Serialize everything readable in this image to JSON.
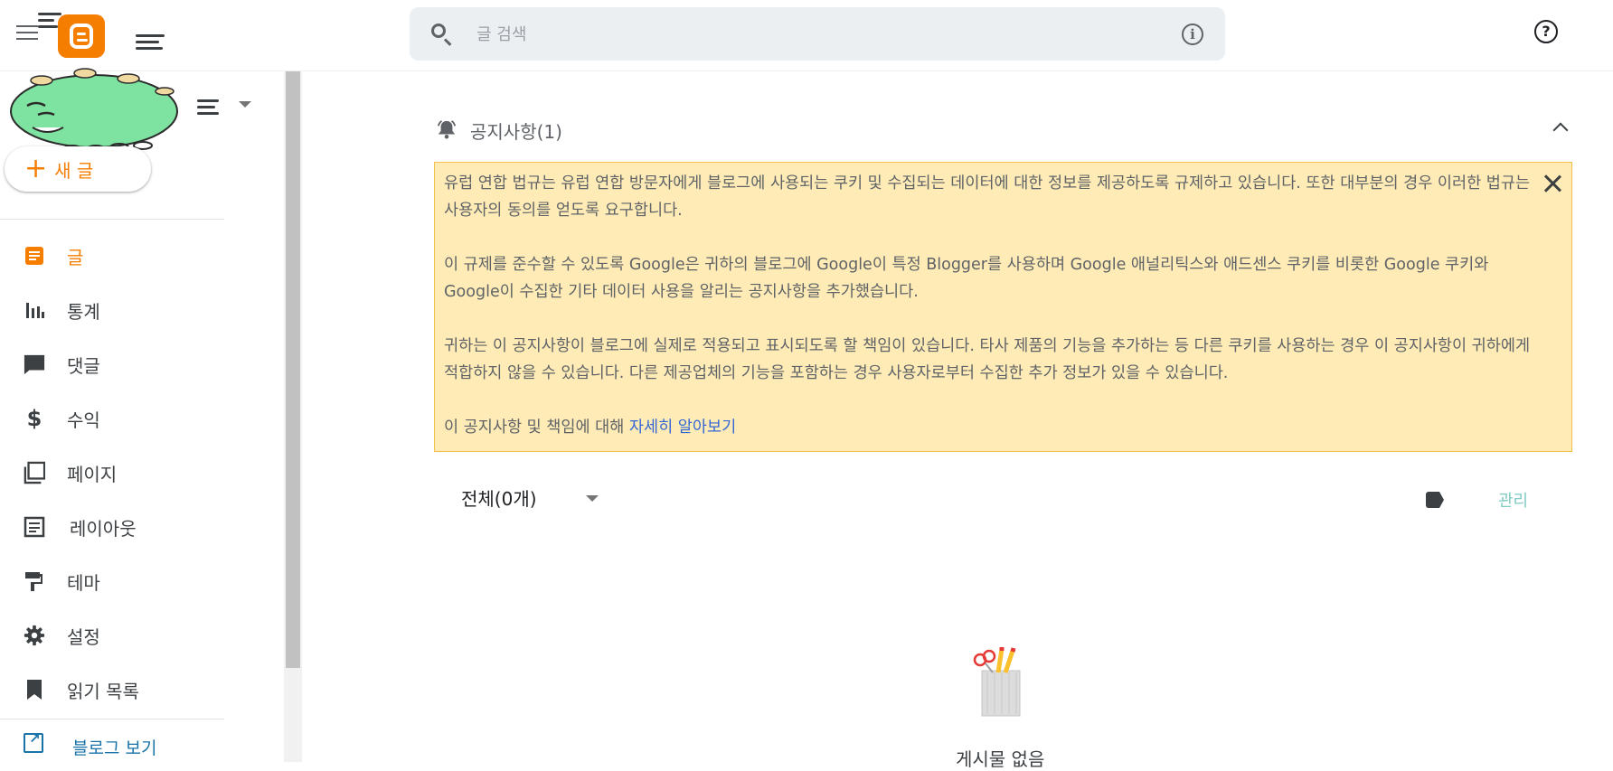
{
  "topbar": {
    "search_placeholder": "글 검색"
  },
  "sidebar": {
    "new_post_label": "새 글",
    "items": [
      {
        "label": "글",
        "icon": "posts-icon",
        "active": true
      },
      {
        "label": "통계",
        "icon": "stats-icon",
        "active": false
      },
      {
        "label": "댓글",
        "icon": "comments-icon",
        "active": false
      },
      {
        "label": "수익",
        "icon": "earnings-icon",
        "active": false
      },
      {
        "label": "페이지",
        "icon": "pages-icon",
        "active": false
      },
      {
        "label": "레이아웃",
        "icon": "layout-icon",
        "active": false
      },
      {
        "label": "테마",
        "icon": "theme-icon",
        "active": false
      },
      {
        "label": "설정",
        "icon": "settings-icon",
        "active": false
      },
      {
        "label": "읽기 목록",
        "icon": "reading-list-icon",
        "active": false
      }
    ],
    "view_blog_label": "블로그 보기"
  },
  "notice": {
    "title": "공지사항(1)",
    "para1": "유럽 연합 법규는 유럽 연합 방문자에게 블로그에 사용되는 쿠키 및 수집되는 데이터에 대한 정보를 제공하도록 규제하고 있습니다. 또한 대부분의 경우 이러한 법규는 사용자의 동의를 얻도록 요구합니다.",
    "para2": "이 규제를 준수할 수 있도록 Google은 귀하의 블로그에 Google이 특정 Blogger를 사용하며 Google 애널리틱스와 애드센스 쿠키를 비롯한 Google 쿠키와 Google이 수집한 기타 데이터 사용을 알리는 공지사항을 추가했습니다.",
    "para3": "귀하는 이 공지사항이 블로그에 실제로 적용되고 표시되도록 할 책임이 있습니다. 타사 제품의 기능을 추가하는 등 다른 쿠키를 사용하는 경우 이 공지사항이 귀하에게 적합하지 않을 수 있습니다. 다른 제공업체의 기능을 포함하는 경우 사용자로부터 수집한 추가 정보가 있을 수 있습니다.",
    "para4_prefix": "이 공지사항 및 책임에 대해 ",
    "learn_more": "자세히 알아보기"
  },
  "posts": {
    "filter_label": "전체(0개)",
    "manage_label": "관리",
    "empty_text": "게시물 없음"
  },
  "colors": {
    "accent": "#f57d00",
    "notice_bg": "#ffebb5",
    "notice_border": "#f5c04a",
    "link": "#3367d6"
  }
}
